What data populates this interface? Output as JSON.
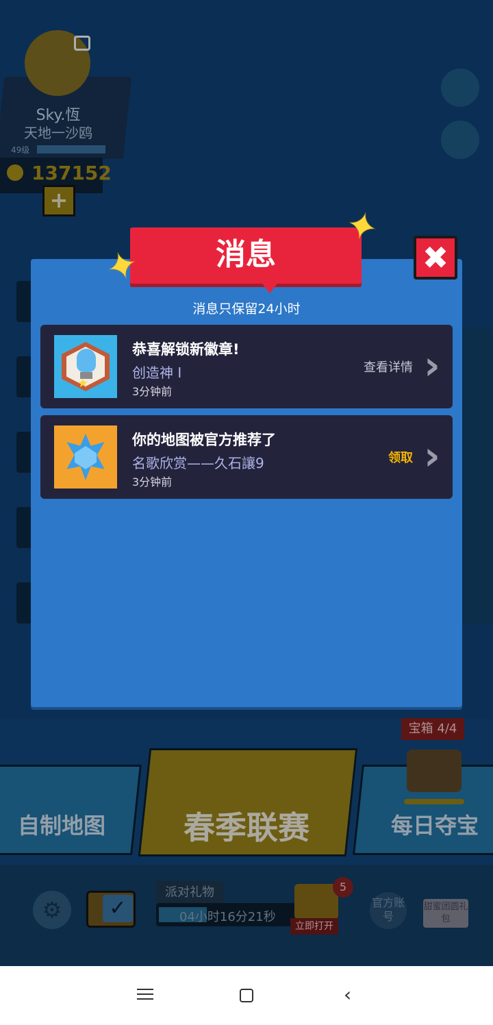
{
  "profile": {
    "name": "Sky.恆",
    "title": "天地一沙鸥",
    "level": "49级",
    "coins": "137152",
    "add_label": "+"
  },
  "modes": {
    "left": "自制地图",
    "center": "春季联赛",
    "right": "每日夺宝",
    "chest_tag": "宝箱 4/4"
  },
  "bottom": {
    "party_label": "派对礼物",
    "timer": "04小时16分21秒",
    "gift_count": "5",
    "gift_open": "立即打开",
    "official": "官方账号",
    "sweet": "甜蜜团圆礼包"
  },
  "dialog": {
    "title": "消息",
    "notice": "消息只保留24小时",
    "close_icon": "close-icon",
    "messages": [
      {
        "title": "恭喜解锁新徽章!",
        "subtitle": "创造神 I",
        "time": "3分钟前",
        "action": "查看详情",
        "icon": "lightbulb-badge-icon",
        "thumb_color": "#3bb3e8"
      },
      {
        "title": "你的地图被官方推荐了",
        "subtitle": "名歌欣赏——久石讓9",
        "time": "3分钟前",
        "action": "领取",
        "icon": "blue-crystal-star-icon",
        "thumb_color": "#f4a22e"
      }
    ]
  },
  "colors": {
    "dialog_bg": "#2d78c8",
    "banner_red": "#e8243d",
    "message_bg": "#23233c",
    "claim_yellow": "#f4b400",
    "star_yellow": "#ffd83a"
  },
  "navbar": {
    "icons": [
      "menu-icon",
      "home-icon",
      "back-icon"
    ]
  }
}
